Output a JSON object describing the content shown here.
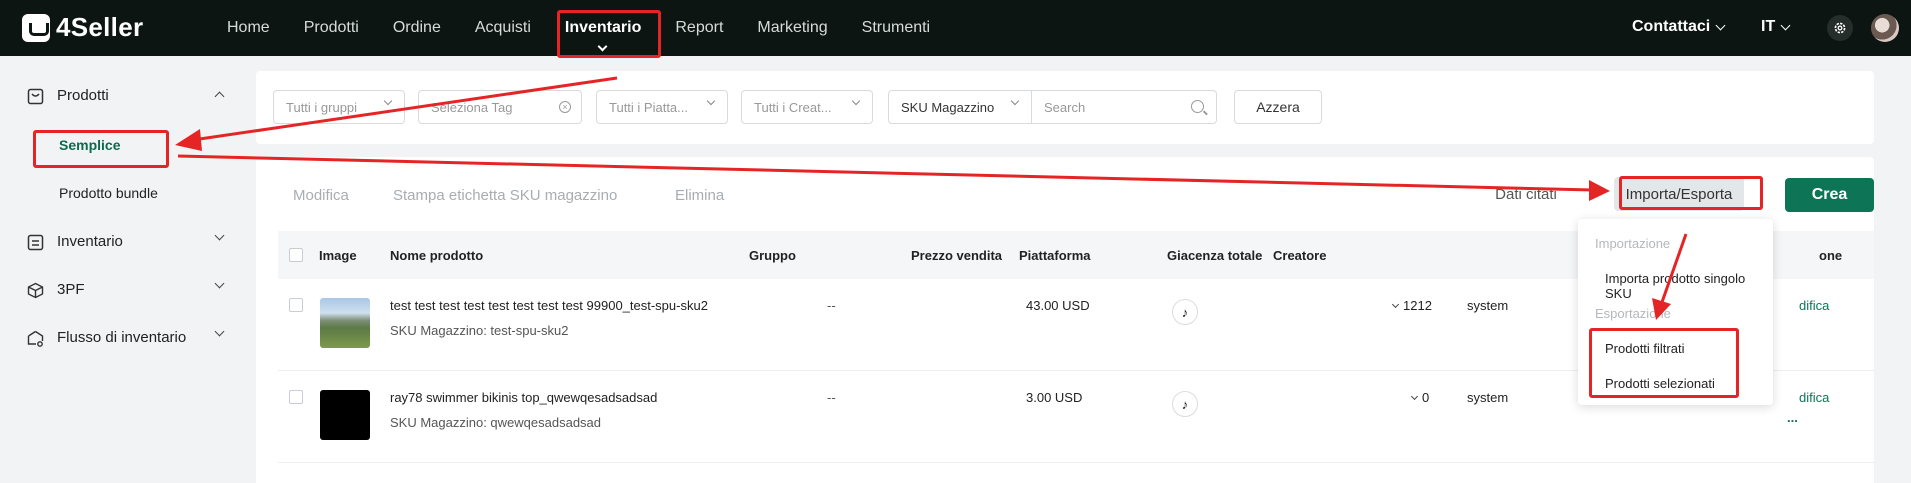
{
  "brand": {
    "name": "4Seller"
  },
  "nav": {
    "items": [
      "Home",
      "Prodotti",
      "Ordine",
      "Acquisti",
      "Inventario",
      "Report",
      "Marketing",
      "Strumenti"
    ],
    "active": "Inventario",
    "contact": "Contattaci",
    "language": "IT"
  },
  "sidebar": {
    "groups": [
      {
        "label": "Prodotti",
        "icon": "box-icon",
        "expanded": true
      },
      {
        "label": "Inventario",
        "icon": "inventory-icon",
        "expanded": false
      },
      {
        "label": "3PF",
        "icon": "cube-icon",
        "expanded": false
      },
      {
        "label": "Flusso di inventario",
        "icon": "flow-icon",
        "expanded": false
      }
    ],
    "subitems": [
      "Semplice",
      "Prodotto bundle"
    ],
    "active_subitem": "Semplice"
  },
  "filters": {
    "groups": "Tutti i gruppi",
    "tag": "Seleziona Tag",
    "platforms": "Tutti i Piatta...",
    "creators": "Tutti i Creat...",
    "sku_type": "SKU Magazzino",
    "search_placeholder": "Search",
    "reset": "Azzera"
  },
  "toolbar": {
    "edit": "Modifica",
    "print_label": "Stampa etichetta SKU magazzino",
    "delete": "Elimina",
    "cited_data": "Dati citati",
    "import_export": "Importa/Esporta",
    "create": "Crea"
  },
  "table": {
    "headers": [
      "Image",
      "Nome prodotto",
      "Gruppo",
      "Prezzo vendita",
      "Piattaforma",
      "Giacenza totale",
      "Creatore",
      "one"
    ],
    "rows": [
      {
        "name": "test test test test test test test test 99900_test-spu-sku2",
        "sku": "SKU Magazzino: test-spu-sku2",
        "group": "--",
        "price": "43.00 USD",
        "platform": "tiktok",
        "stock": "1212",
        "creator": "system",
        "action": "difica"
      },
      {
        "name": "ray78 swimmer bikinis top_qwewqesadsadsad",
        "sku": "SKU Magazzino: qwewqesadsadsad",
        "group": "--",
        "price": "3.00 USD",
        "platform": "tiktok",
        "stock": "0",
        "creator": "system",
        "action": "difica",
        "more": "..."
      }
    ]
  },
  "dropdown": {
    "import_heading": "Importazione",
    "import_single": "Importa prodotto singolo SKU",
    "export_heading": "Esportazione",
    "export_filtered": "Prodotti filtrati",
    "export_selected": "Prodotti selezionati"
  },
  "colors": {
    "brand_green": "#0d7556",
    "nav_bg": "#0c1512",
    "annotation_red": "#e52525"
  }
}
